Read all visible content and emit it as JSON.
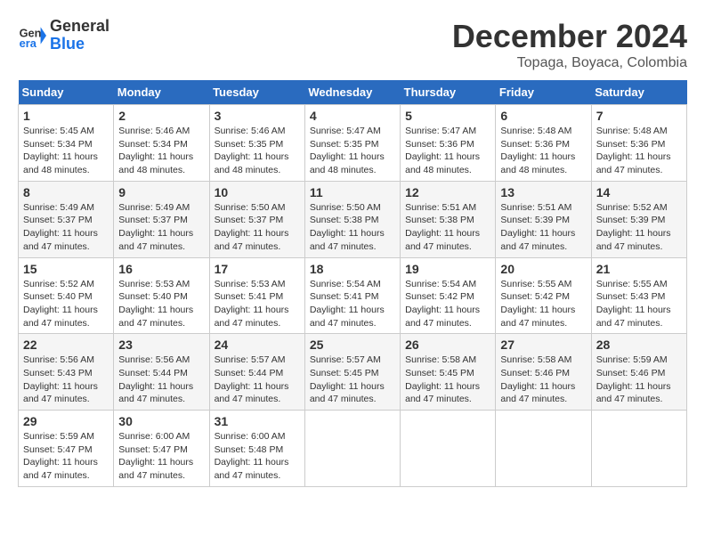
{
  "logo": {
    "text_general": "General",
    "text_blue": "Blue"
  },
  "title": {
    "month_year": "December 2024",
    "location": "Topaga, Boyaca, Colombia"
  },
  "days_of_week": [
    "Sunday",
    "Monday",
    "Tuesday",
    "Wednesday",
    "Thursday",
    "Friday",
    "Saturday"
  ],
  "weeks": [
    [
      {
        "day": "1",
        "sunrise": "Sunrise: 5:45 AM",
        "sunset": "Sunset: 5:34 PM",
        "daylight": "Daylight: 11 hours and 48 minutes."
      },
      {
        "day": "2",
        "sunrise": "Sunrise: 5:46 AM",
        "sunset": "Sunset: 5:34 PM",
        "daylight": "Daylight: 11 hours and 48 minutes."
      },
      {
        "day": "3",
        "sunrise": "Sunrise: 5:46 AM",
        "sunset": "Sunset: 5:35 PM",
        "daylight": "Daylight: 11 hours and 48 minutes."
      },
      {
        "day": "4",
        "sunrise": "Sunrise: 5:47 AM",
        "sunset": "Sunset: 5:35 PM",
        "daylight": "Daylight: 11 hours and 48 minutes."
      },
      {
        "day": "5",
        "sunrise": "Sunrise: 5:47 AM",
        "sunset": "Sunset: 5:36 PM",
        "daylight": "Daylight: 11 hours and 48 minutes."
      },
      {
        "day": "6",
        "sunrise": "Sunrise: 5:48 AM",
        "sunset": "Sunset: 5:36 PM",
        "daylight": "Daylight: 11 hours and 48 minutes."
      },
      {
        "day": "7",
        "sunrise": "Sunrise: 5:48 AM",
        "sunset": "Sunset: 5:36 PM",
        "daylight": "Daylight: 11 hours and 47 minutes."
      }
    ],
    [
      {
        "day": "8",
        "sunrise": "Sunrise: 5:49 AM",
        "sunset": "Sunset: 5:37 PM",
        "daylight": "Daylight: 11 hours and 47 minutes."
      },
      {
        "day": "9",
        "sunrise": "Sunrise: 5:49 AM",
        "sunset": "Sunset: 5:37 PM",
        "daylight": "Daylight: 11 hours and 47 minutes."
      },
      {
        "day": "10",
        "sunrise": "Sunrise: 5:50 AM",
        "sunset": "Sunset: 5:37 PM",
        "daylight": "Daylight: 11 hours and 47 minutes."
      },
      {
        "day": "11",
        "sunrise": "Sunrise: 5:50 AM",
        "sunset": "Sunset: 5:38 PM",
        "daylight": "Daylight: 11 hours and 47 minutes."
      },
      {
        "day": "12",
        "sunrise": "Sunrise: 5:51 AM",
        "sunset": "Sunset: 5:38 PM",
        "daylight": "Daylight: 11 hours and 47 minutes."
      },
      {
        "day": "13",
        "sunrise": "Sunrise: 5:51 AM",
        "sunset": "Sunset: 5:39 PM",
        "daylight": "Daylight: 11 hours and 47 minutes."
      },
      {
        "day": "14",
        "sunrise": "Sunrise: 5:52 AM",
        "sunset": "Sunset: 5:39 PM",
        "daylight": "Daylight: 11 hours and 47 minutes."
      }
    ],
    [
      {
        "day": "15",
        "sunrise": "Sunrise: 5:52 AM",
        "sunset": "Sunset: 5:40 PM",
        "daylight": "Daylight: 11 hours and 47 minutes."
      },
      {
        "day": "16",
        "sunrise": "Sunrise: 5:53 AM",
        "sunset": "Sunset: 5:40 PM",
        "daylight": "Daylight: 11 hours and 47 minutes."
      },
      {
        "day": "17",
        "sunrise": "Sunrise: 5:53 AM",
        "sunset": "Sunset: 5:41 PM",
        "daylight": "Daylight: 11 hours and 47 minutes."
      },
      {
        "day": "18",
        "sunrise": "Sunrise: 5:54 AM",
        "sunset": "Sunset: 5:41 PM",
        "daylight": "Daylight: 11 hours and 47 minutes."
      },
      {
        "day": "19",
        "sunrise": "Sunrise: 5:54 AM",
        "sunset": "Sunset: 5:42 PM",
        "daylight": "Daylight: 11 hours and 47 minutes."
      },
      {
        "day": "20",
        "sunrise": "Sunrise: 5:55 AM",
        "sunset": "Sunset: 5:42 PM",
        "daylight": "Daylight: 11 hours and 47 minutes."
      },
      {
        "day": "21",
        "sunrise": "Sunrise: 5:55 AM",
        "sunset": "Sunset: 5:43 PM",
        "daylight": "Daylight: 11 hours and 47 minutes."
      }
    ],
    [
      {
        "day": "22",
        "sunrise": "Sunrise: 5:56 AM",
        "sunset": "Sunset: 5:43 PM",
        "daylight": "Daylight: 11 hours and 47 minutes."
      },
      {
        "day": "23",
        "sunrise": "Sunrise: 5:56 AM",
        "sunset": "Sunset: 5:44 PM",
        "daylight": "Daylight: 11 hours and 47 minutes."
      },
      {
        "day": "24",
        "sunrise": "Sunrise: 5:57 AM",
        "sunset": "Sunset: 5:44 PM",
        "daylight": "Daylight: 11 hours and 47 minutes."
      },
      {
        "day": "25",
        "sunrise": "Sunrise: 5:57 AM",
        "sunset": "Sunset: 5:45 PM",
        "daylight": "Daylight: 11 hours and 47 minutes."
      },
      {
        "day": "26",
        "sunrise": "Sunrise: 5:58 AM",
        "sunset": "Sunset: 5:45 PM",
        "daylight": "Daylight: 11 hours and 47 minutes."
      },
      {
        "day": "27",
        "sunrise": "Sunrise: 5:58 AM",
        "sunset": "Sunset: 5:46 PM",
        "daylight": "Daylight: 11 hours and 47 minutes."
      },
      {
        "day": "28",
        "sunrise": "Sunrise: 5:59 AM",
        "sunset": "Sunset: 5:46 PM",
        "daylight": "Daylight: 11 hours and 47 minutes."
      }
    ],
    [
      {
        "day": "29",
        "sunrise": "Sunrise: 5:59 AM",
        "sunset": "Sunset: 5:47 PM",
        "daylight": "Daylight: 11 hours and 47 minutes."
      },
      {
        "day": "30",
        "sunrise": "Sunrise: 6:00 AM",
        "sunset": "Sunset: 5:47 PM",
        "daylight": "Daylight: 11 hours and 47 minutes."
      },
      {
        "day": "31",
        "sunrise": "Sunrise: 6:00 AM",
        "sunset": "Sunset: 5:48 PM",
        "daylight": "Daylight: 11 hours and 47 minutes."
      },
      null,
      null,
      null,
      null
    ]
  ]
}
